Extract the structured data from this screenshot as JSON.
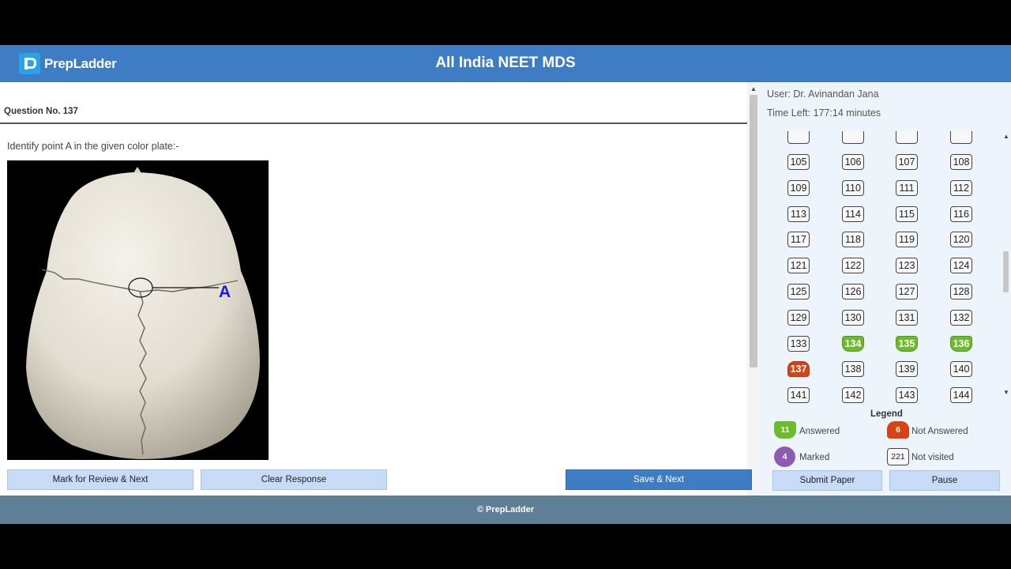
{
  "header": {
    "logo_text": "PrepLadder",
    "title": "All India NEET MDS"
  },
  "question": {
    "number_label": "Question No. 137",
    "text": "Identify point A in the given color plate:-",
    "image_label": "A"
  },
  "actions": {
    "mark_review": "Mark for Review & Next",
    "clear": "Clear Response",
    "save_next": "Save & Next"
  },
  "side": {
    "user": "User: Dr. Avinandan Jana",
    "time_left": "Time Left: 177:14 minutes"
  },
  "palette": {
    "questions": [
      {
        "n": "105",
        "s": "nv"
      },
      {
        "n": "106",
        "s": "nv"
      },
      {
        "n": "107",
        "s": "nv"
      },
      {
        "n": "108",
        "s": "nv"
      },
      {
        "n": "109",
        "s": "nv"
      },
      {
        "n": "110",
        "s": "nv"
      },
      {
        "n": "111",
        "s": "nv"
      },
      {
        "n": "112",
        "s": "nv"
      },
      {
        "n": "113",
        "s": "nv"
      },
      {
        "n": "114",
        "s": "nv"
      },
      {
        "n": "115",
        "s": "nv"
      },
      {
        "n": "116",
        "s": "nv"
      },
      {
        "n": "117",
        "s": "nv"
      },
      {
        "n": "118",
        "s": "nv"
      },
      {
        "n": "119",
        "s": "nv"
      },
      {
        "n": "120",
        "s": "nv"
      },
      {
        "n": "121",
        "s": "nv"
      },
      {
        "n": "122",
        "s": "nv"
      },
      {
        "n": "123",
        "s": "nv"
      },
      {
        "n": "124",
        "s": "nv"
      },
      {
        "n": "125",
        "s": "nv"
      },
      {
        "n": "126",
        "s": "nv"
      },
      {
        "n": "127",
        "s": "nv"
      },
      {
        "n": "128",
        "s": "nv"
      },
      {
        "n": "129",
        "s": "nv"
      },
      {
        "n": "130",
        "s": "nv"
      },
      {
        "n": "131",
        "s": "nv"
      },
      {
        "n": "132",
        "s": "nv"
      },
      {
        "n": "133",
        "s": "nv"
      },
      {
        "n": "134",
        "s": "answered"
      },
      {
        "n": "135",
        "s": "answered"
      },
      {
        "n": "136",
        "s": "answered"
      },
      {
        "n": "137",
        "s": "notans"
      },
      {
        "n": "138",
        "s": "nv"
      },
      {
        "n": "139",
        "s": "nv"
      },
      {
        "n": "140",
        "s": "nv"
      },
      {
        "n": "141",
        "s": "nv"
      },
      {
        "n": "142",
        "s": "nv"
      },
      {
        "n": "143",
        "s": "nv"
      },
      {
        "n": "144",
        "s": "nv"
      }
    ]
  },
  "legend": {
    "title": "Legend",
    "answered_count": "11",
    "answered_label": "Answered",
    "not_answered_count": "6",
    "not_answered_label": "Not Answered",
    "marked_count": "4",
    "marked_label": "Marked",
    "not_visited_count": "221",
    "not_visited_label": "Not visited"
  },
  "controls": {
    "submit": "Submit Paper",
    "pause": "Pause"
  },
  "footer": {
    "text": "© PrepLadder"
  },
  "colors": {
    "brand": "#3e7cc4",
    "answered": "#6cbb2b",
    "not_answered": "#d84315",
    "marked": "#8e5bb0",
    "footer": "#5e7f95"
  }
}
